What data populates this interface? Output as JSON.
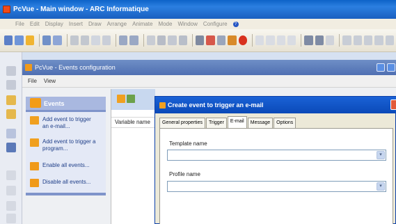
{
  "main_window": {
    "title": "PcVue - Main window - ARC Informatique",
    "menu": [
      "File",
      "Edit",
      "Display",
      "Insert",
      "Draw",
      "Arrange",
      "Animate",
      "Mode",
      "Window",
      "Configure"
    ]
  },
  "events_window": {
    "title": "PcVue - Events configuration",
    "menu": [
      "File",
      "View"
    ],
    "task_panel": {
      "header": "Events",
      "items": [
        {
          "label": "Add event to trigger an e-mail..."
        },
        {
          "label": "Add event to trigger a program..."
        },
        {
          "label": "Enable all events..."
        },
        {
          "label": "Disable all events..."
        }
      ]
    },
    "list": {
      "column_header": "Variable name"
    }
  },
  "dialog": {
    "title": "Create event to trigger an e-mail",
    "tabs": [
      "General properties",
      "Trigger",
      "E-mail",
      "Message",
      "Options"
    ],
    "active_tab": "E-mail",
    "fields": {
      "template_name": {
        "label": "Template name",
        "value": ""
      },
      "profile_name": {
        "label": "Profile name",
        "value": ""
      }
    }
  },
  "colors": {
    "xp_title": "#0a49b8",
    "panel_blue": "#7f94ca",
    "link_blue": "#1e3e88"
  }
}
